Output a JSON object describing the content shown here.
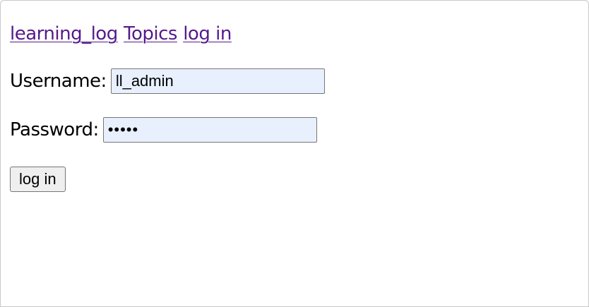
{
  "nav": {
    "home_link": "learning_log",
    "topics_link": "Topics",
    "login_link": "log in"
  },
  "form": {
    "username_label": "Username:",
    "username_value": "ll_admin",
    "password_label": "Password:",
    "password_value": "•••••",
    "submit_label": "log in"
  },
  "colors": {
    "visited_link": "#551a8b",
    "autofill_background": "#e8f0fe"
  }
}
